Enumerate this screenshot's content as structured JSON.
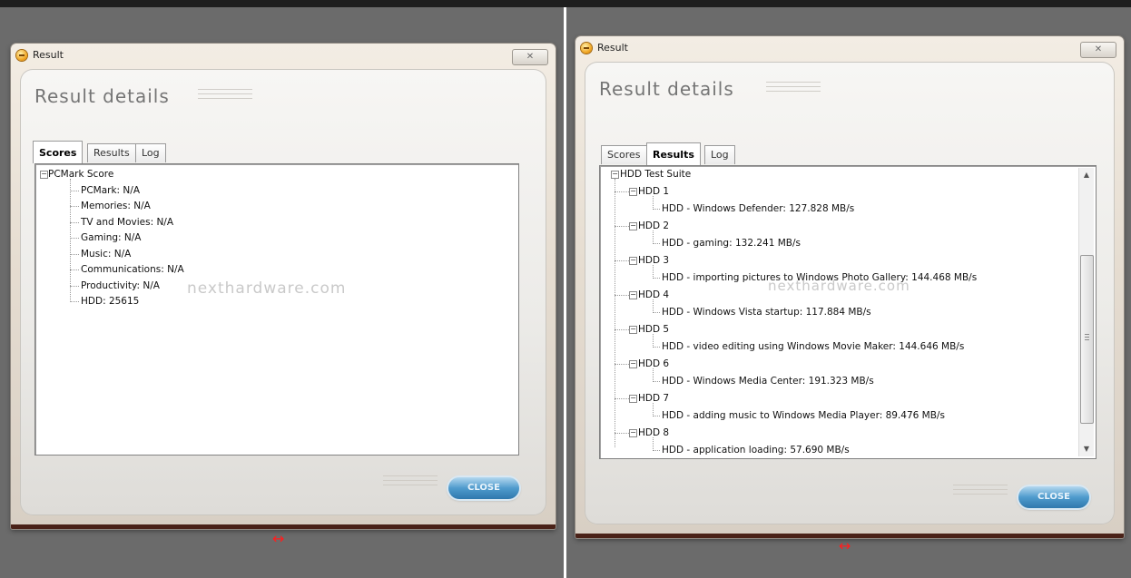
{
  "left": {
    "window_title": "Result",
    "close_x": "✕",
    "heading": "Result details",
    "tabs": [
      {
        "label": "Scores",
        "active": true
      },
      {
        "label": "Results",
        "active": false
      },
      {
        "label": "Log",
        "active": false
      }
    ],
    "tree": {
      "root": "PCMark Score",
      "root_expander": "−",
      "items": [
        "PCMark: N/A",
        "Memories: N/A",
        "TV and Movies: N/A",
        "Gaming: N/A",
        "Music: N/A",
        "Communications: N/A",
        "Productivity: N/A",
        "HDD: 25615"
      ]
    },
    "watermark": "nexthardware.com",
    "close_button": "CLOSE",
    "arrow": "↔"
  },
  "right": {
    "window_title": "Result",
    "close_x": "✕",
    "heading": "Result details",
    "tabs": [
      {
        "label": "Scores",
        "active": false
      },
      {
        "label": "Results",
        "active": true
      },
      {
        "label": "Log",
        "active": false
      }
    ],
    "tree": {
      "root": "HDD Test Suite",
      "expander": "−",
      "groups": [
        {
          "label": "HDD 1",
          "child": "HDD - Windows Defender: 127.828 MB/s"
        },
        {
          "label": "HDD 2",
          "child": "HDD - gaming: 132.241 MB/s"
        },
        {
          "label": "HDD 3",
          "child": "HDD - importing pictures to Windows Photo Gallery: 144.468 MB/s"
        },
        {
          "label": "HDD 4",
          "child": "HDD - Windows Vista startup: 117.884 MB/s"
        },
        {
          "label": "HDD 5",
          "child": "HDD - video editing using Windows Movie Maker: 144.646 MB/s"
        },
        {
          "label": "HDD 6",
          "child": "HDD - Windows Media Center: 191.323 MB/s"
        },
        {
          "label": "HDD 7",
          "child": "HDD - adding music to Windows Media Player: 89.476 MB/s"
        },
        {
          "label": "HDD 8",
          "child": "HDD - application loading: 57.690 MB/s"
        }
      ]
    },
    "scroll_up": "▲",
    "scroll_down": "▼",
    "watermark": "nexthardware.com",
    "close_button": "CLOSE",
    "arrow": "↔"
  }
}
